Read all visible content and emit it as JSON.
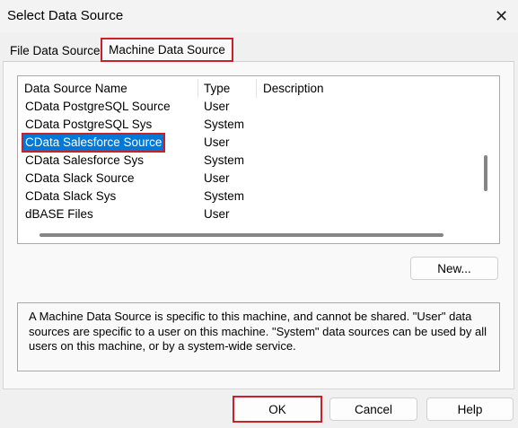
{
  "window": {
    "title": "Select Data Source",
    "close_glyph": "✕"
  },
  "tabs": [
    {
      "label": "File Data Source",
      "selected": false
    },
    {
      "label": "Machine Data Source",
      "selected": true
    }
  ],
  "list": {
    "columns": [
      "Data Source Name",
      "Type",
      "Description"
    ],
    "rows": [
      {
        "name": "CData PostgreSQL Source",
        "type": "User",
        "selected": false
      },
      {
        "name": "CData PostgreSQL Sys",
        "type": "System",
        "selected": false
      },
      {
        "name": "CData Salesforce Source",
        "type": "User",
        "selected": true
      },
      {
        "name": "CData Salesforce Sys",
        "type": "System",
        "selected": false
      },
      {
        "name": "CData Slack Source",
        "type": "User",
        "selected": false
      },
      {
        "name": "CData Slack Sys",
        "type": "System",
        "selected": false
      },
      {
        "name": "dBASE Files",
        "type": "User",
        "selected": false
      }
    ]
  },
  "buttons": {
    "new": "New...",
    "ok": "OK",
    "cancel": "Cancel",
    "help": "Help"
  },
  "description": "A Machine Data Source is specific to this machine, and cannot be shared.  \"User\" data sources are specific to a user on this machine.  \"System\" data sources can be used by all users on this machine, or by a system-wide service.",
  "colors": {
    "selection": "#0078d7",
    "highlight_border": "#cc2028"
  }
}
